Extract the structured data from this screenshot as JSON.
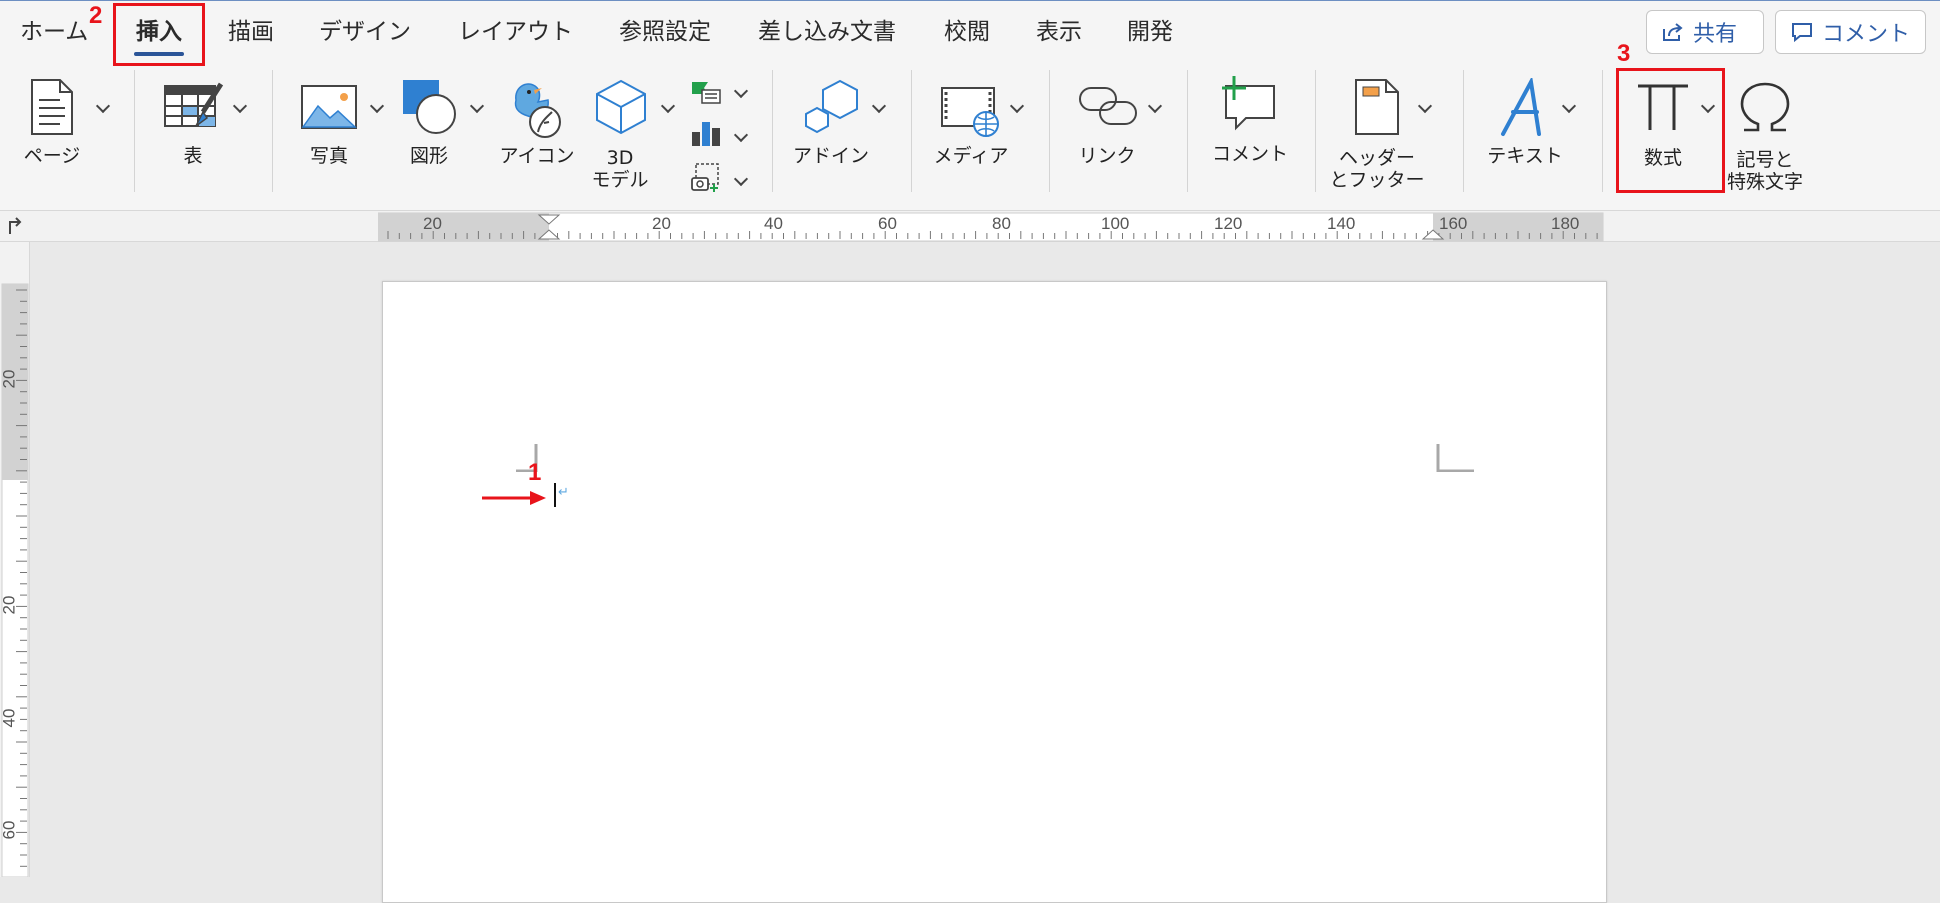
{
  "tabs": [
    {
      "label": "ホーム"
    },
    {
      "label": "挿入",
      "active": true
    },
    {
      "label": "描画"
    },
    {
      "label": "デザイン"
    },
    {
      "label": "レイアウト"
    },
    {
      "label": "参照設定"
    },
    {
      "label": "差し込み文書"
    },
    {
      "label": "校閲"
    },
    {
      "label": "表示"
    },
    {
      "label": "開発"
    }
  ],
  "header_buttons": {
    "share": "共有",
    "comment": "コメント"
  },
  "ribbon": {
    "page": "ページ",
    "table": "表",
    "photo": "写真",
    "shapes": "図形",
    "icons": "アイコン",
    "model3d_line1": "3D",
    "model3d_line2": "モデル",
    "addins": "アドイン",
    "media": "メディア",
    "link": "リンク",
    "comment": "コメント",
    "header_footer_line1": "ヘッダー",
    "header_footer_line2": "とフッター",
    "text": "テキスト",
    "equation": "数式",
    "symbols_line1": "記号と",
    "symbols_line2": "特殊文字"
  },
  "annotations": {
    "step1": "1",
    "step2": "2",
    "step3": "3"
  },
  "ruler_h_labels": [
    "20",
    "20",
    "40",
    "60",
    "80",
    "100",
    "120",
    "140",
    "160",
    "180"
  ],
  "ruler_v_labels": [
    "20",
    "20",
    "40",
    "60"
  ],
  "colors": {
    "accent_blue": "#2b5598",
    "highlight_red": "#e8141b",
    "icon_blue": "#2f80d1"
  }
}
